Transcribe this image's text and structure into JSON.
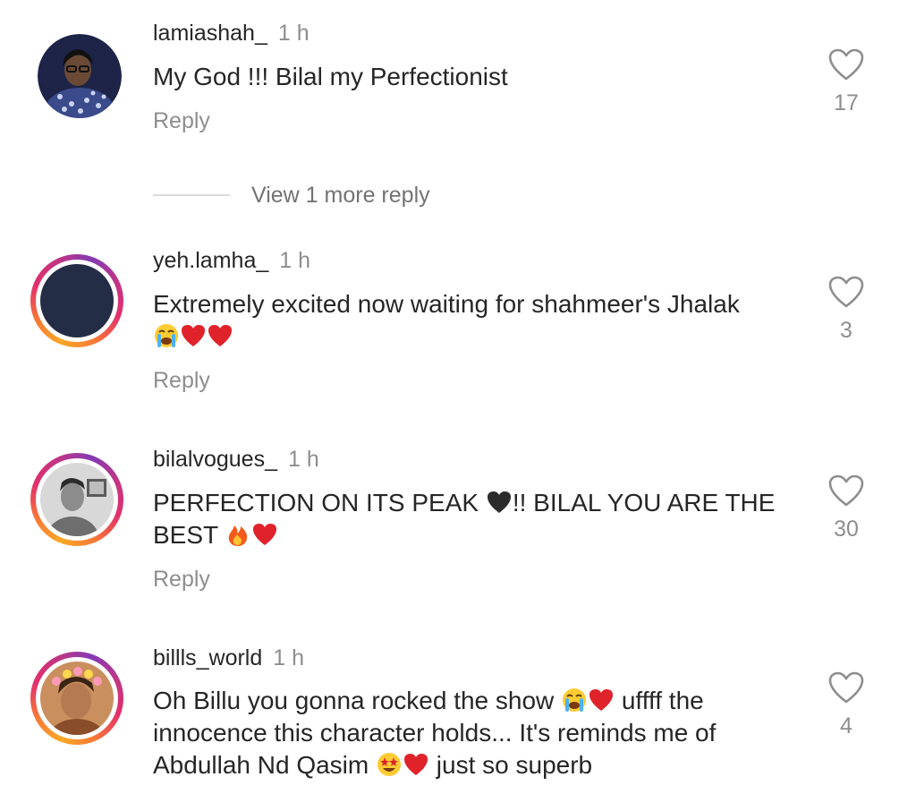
{
  "comments": [
    {
      "username": "lamiashah_",
      "time": "1 h",
      "text": "My God !!! Bilal my Perfectionist",
      "reply_label": "Reply",
      "likes": "17",
      "has_story_ring": false,
      "avatar_bg": "#20274a"
    },
    {
      "username": "yeh.lamha_",
      "time": "1 h",
      "text": "Extremely excited now waiting for shahmeer's Jhalak",
      "text_emoji": [
        "crying-face",
        "red-heart",
        "red-heart"
      ],
      "reply_label": "Reply",
      "likes": "3",
      "has_story_ring": true,
      "avatar_bg": "#232d45"
    },
    {
      "username": "bilalvogues_",
      "time": "1 h",
      "text_part1": "PERFECTION ON ITS PEAK ",
      "text_part2": "!! BILAL YOU ARE THE",
      "text_part3": "BEST ",
      "reply_label": "Reply",
      "likes": "30",
      "has_story_ring": true,
      "avatar_bg": "#9a9a9a"
    },
    {
      "username": "billls_world",
      "time": "1 h",
      "text_part1": "Oh Billu you gonna rocked the show ",
      "text_part2": " uffff the",
      "text_part3": "innocence this character holds... It's reminds me of",
      "text_part4": "Abdullah Nd Qasim ",
      "text_part5": " just so superb",
      "likes": "4",
      "has_story_ring": true,
      "avatar_bg": "#b07a4e"
    }
  ],
  "view_more_label": "View 1 more reply",
  "colors": {
    "text": "#262626",
    "muted": "#8e8e8e",
    "heart_red": "#e0222b"
  }
}
